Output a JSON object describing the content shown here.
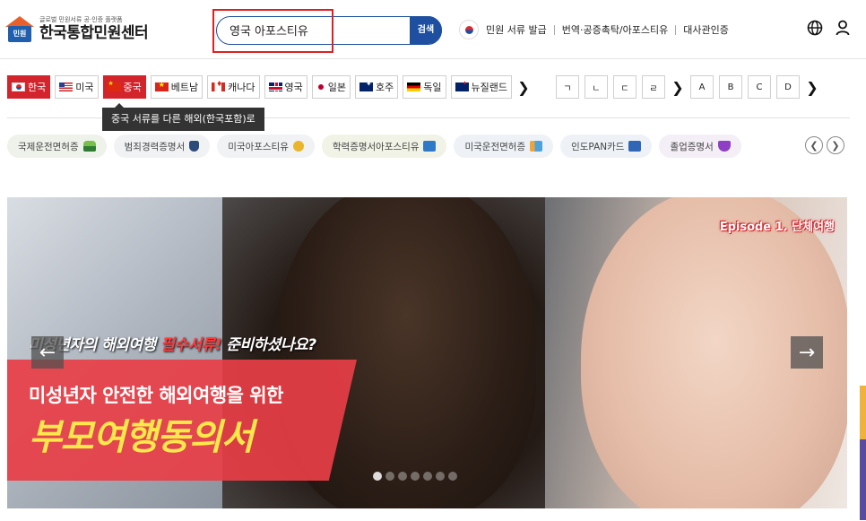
{
  "header": {
    "logo_badge": "민원",
    "logo_subtitle": "글로벌 민원서류 공·인증 플랫폼",
    "logo_title": "한국통합민원센터",
    "search_value": "영국 아포스티유",
    "search_button": "검색",
    "nav_links": [
      "민원 서류 발급",
      "번역·공증촉탁/아포스티유",
      "대사관인증"
    ],
    "icons": [
      "globe-icon",
      "user-icon"
    ]
  },
  "countries": [
    {
      "name": "한국",
      "flag": "kr",
      "state": "active"
    },
    {
      "name": "미국",
      "flag": "us",
      "state": ""
    },
    {
      "name": "중국",
      "flag": "cn",
      "state": "selected"
    },
    {
      "name": "베트남",
      "flag": "vn",
      "state": ""
    },
    {
      "name": "캐나다",
      "flag": "ca",
      "state": ""
    },
    {
      "name": "영국",
      "flag": "gb",
      "state": ""
    },
    {
      "name": "일본",
      "flag": "jp",
      "state": ""
    },
    {
      "name": "호주",
      "flag": "au",
      "state": ""
    },
    {
      "name": "독일",
      "flag": "de",
      "state": ""
    },
    {
      "name": "뉴질랜드",
      "flag": "nz",
      "state": ""
    }
  ],
  "letters": [
    "ㄱ",
    "ㄴ",
    "ㄷ",
    "ㄹ",
    "A",
    "B",
    "C",
    "D"
  ],
  "tooltip": "중국 서류를 다른 해외(한국포함)로",
  "quick_chips": [
    {
      "label": "국제운전면허증",
      "icon": "car-icon"
    },
    {
      "label": "범죄경력증명서",
      "icon": "shield-icon"
    },
    {
      "label": "미국아포스티유",
      "icon": "medal-icon"
    },
    {
      "label": "학력증명서아포스티유",
      "icon": "folder-icon"
    },
    {
      "label": "미국운전면허증",
      "icon": "license-icon"
    },
    {
      "label": "인도PAN카드",
      "icon": "card-icon"
    },
    {
      "label": "졸업증명서",
      "icon": "gem-icon"
    }
  ],
  "banner": {
    "episode": "Episode 1. 단체여행",
    "headline_pre": "미성년자의 해외여행 ",
    "headline_emph": "필수서류!",
    "headline_post": " 준비하셨나요?",
    "sub1": "미성년자 안전한 해외여행을 위한",
    "sub2": "부모여행동의서",
    "slide_count": 7,
    "active_slide": 0
  },
  "colors": {
    "accent_red": "#d3242c",
    "accent_blue": "#1f4fa0",
    "banner_red": "#e83e46",
    "banner_yellow": "#ffe94a"
  }
}
